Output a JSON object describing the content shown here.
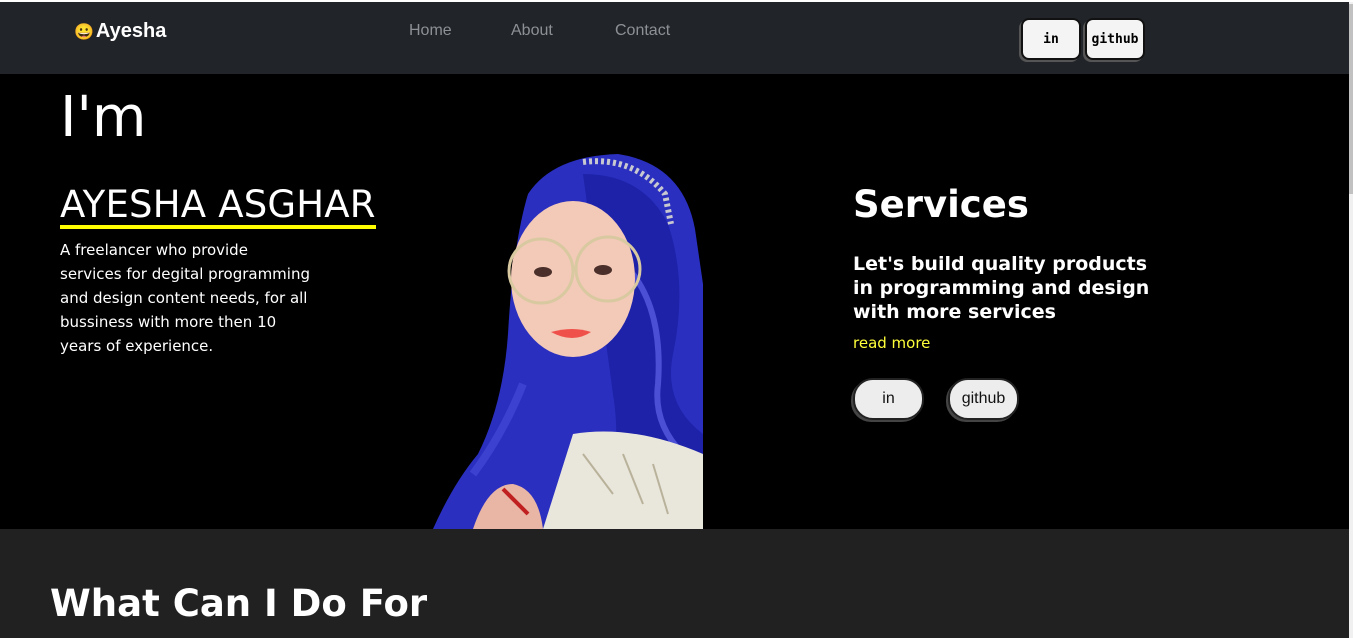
{
  "navbar": {
    "brand_emoji": "😀",
    "brand": "Ayesha",
    "links": [
      "Home",
      "About",
      "Contact"
    ],
    "buttons": [
      "in",
      "github"
    ]
  },
  "hero": {
    "im": "I'm",
    "name": "AYESHA ASGHAR",
    "intro": "A freelancer who provide services for degital programming and design content needs, for all bussiness with more then 10 years of experience."
  },
  "services": {
    "title": "Services",
    "description": "Let's build quality products in programming and design with more services",
    "read_more": "read more",
    "buttons": [
      "in",
      "github"
    ]
  },
  "section2": {
    "title": "What Can I Do For"
  },
  "colors": {
    "accent": "#ffff00",
    "navbar_bg": "#212529",
    "hero_bg": "#000000",
    "section_bg": "#212121"
  }
}
